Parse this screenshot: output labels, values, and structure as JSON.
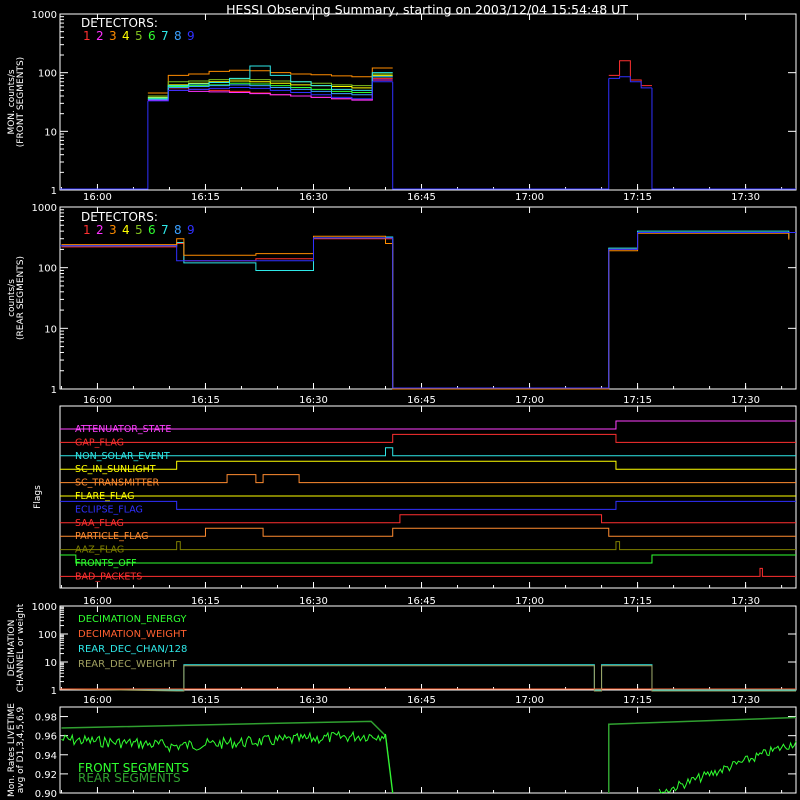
{
  "title": "HESSI Observing Summary, starting on 2003/12/04 15:54:48 UT",
  "time_ticks": [
    "16:00",
    "16:15",
    "16:30",
    "16:45",
    "17:00",
    "17:15",
    "17:30"
  ],
  "detectors": {
    "label": "DETECTORS:",
    "numbers": [
      "1",
      "2",
      "3",
      "4",
      "5",
      "6",
      "7",
      "8",
      "9"
    ],
    "colors": [
      "#ff3030",
      "#ff30ff",
      "#ff8c00",
      "#ffff00",
      "#80c020",
      "#30ff30",
      "#2ee8e8",
      "#3aa0ff",
      "#3030ff"
    ]
  },
  "panels": {
    "front": {
      "ylabel": [
        "MON. counts/s",
        "(FRONT SEGMENTS)"
      ],
      "yticks": [
        "1000",
        "100",
        "10",
        "1"
      ]
    },
    "rear": {
      "ylabel": [
        "counts/s",
        "(REAR SEGMENTS)"
      ],
      "yticks": [
        "1000",
        "100",
        "10",
        "1"
      ]
    },
    "flags": {
      "ylabel": [
        "Flags"
      ]
    },
    "decimation": {
      "ylabel": [
        "DECIMATION",
        "CHANNEL or weight"
      ],
      "yticks": [
        "1000",
        "100",
        "10",
        "1"
      ]
    },
    "livetime": {
      "ylabel": [
        "Mon. Rates LIVETIME",
        "avg of D1,3,4,5,6,9"
      ],
      "yticks": [
        "0.98",
        "0.96",
        "0.94",
        "0.92",
        "0.90"
      ]
    }
  },
  "flags": [
    {
      "name": "ATTENUATOR_STATE",
      "color": "#ff40ff"
    },
    {
      "name": "GAP_FLAG",
      "color": "#ff3030"
    },
    {
      "name": "NON_SOLAR_EVENT",
      "color": "#2ee8e8"
    },
    {
      "name": "SC_IN_SUNLIGHT",
      "color": "#ffff00"
    },
    {
      "name": "SC_TRANSMITTER",
      "color": "#ff8c30"
    },
    {
      "name": "FLARE_FLAG",
      "color": "#ffff00"
    },
    {
      "name": "ECLIPSE_FLAG",
      "color": "#3030ff"
    },
    {
      "name": "SAA_FLAG",
      "color": "#ff3030"
    },
    {
      "name": "PARTICLE_FLAG",
      "color": "#ff8c30"
    },
    {
      "name": "AAZ_FLAG",
      "color": "#808000"
    },
    {
      "name": "FRONTS_OFF",
      "color": "#30ff30"
    },
    {
      "name": "BAD_PACKETS",
      "color": "#ff3030"
    }
  ],
  "decimation_legend": [
    {
      "name": "DECIMATION_ENERGY",
      "color": "#30ff30"
    },
    {
      "name": "DECIMATION_WEIGHT",
      "color": "#ff6030"
    },
    {
      "name": "REAR_DEC_CHAN/128",
      "color": "#2ee8e8"
    },
    {
      "name": "REAR_DEC_WEIGHT",
      "color": "#a0a060"
    }
  ],
  "livetime_legend": [
    {
      "name": "FRONT SEGMENTS",
      "color": "#30ff30"
    },
    {
      "name": "REAR SEGMENTS",
      "color": "#30a030"
    }
  ],
  "chart_data": {
    "type": "line",
    "title": "HESSI Observing Summary, starting on 2003/12/04 15:54:48 UT",
    "x_unit": "UT time (minutes after 15:54:48)",
    "xlim": [
      "15:54:48",
      "17:37:00"
    ],
    "front_counts": {
      "yscale": "log",
      "ylim": [
        1,
        1000
      ],
      "segments": [
        {
          "start": "16:07",
          "end": "16:41",
          "series": [
            {
              "name": "1",
              "values": [
                35,
                55,
                52,
                50,
                48,
                45,
                42,
                40,
                38,
                36,
                35,
                80
              ]
            },
            {
              "name": "2",
              "values": [
                34,
                50,
                48,
                47,
                46,
                44,
                42,
                40,
                38,
                36,
                34,
                75
              ]
            },
            {
              "name": "3",
              "values": [
                45,
                90,
                95,
                105,
                110,
                108,
                100,
                95,
                92,
                88,
                85,
                120
              ]
            },
            {
              "name": "4",
              "values": [
                38,
                62,
                66,
                70,
                72,
                70,
                66,
                62,
                60,
                58,
                55,
                90
              ]
            },
            {
              "name": "5",
              "values": [
                40,
                70,
                72,
                76,
                78,
                76,
                72,
                70,
                66,
                62,
                60,
                95
              ]
            },
            {
              "name": "6",
              "values": [
                36,
                58,
                60,
                62,
                66,
                64,
                60,
                56,
                52,
                48,
                46,
                85
              ]
            },
            {
              "name": "7",
              "values": [
                37,
                60,
                64,
                68,
                80,
                130,
                90,
                70,
                60,
                52,
                50,
                100
              ]
            },
            {
              "name": "8",
              "values": [
                35,
                56,
                58,
                60,
                62,
                60,
                56,
                52,
                48,
                44,
                42,
                85
              ]
            },
            {
              "name": "9",
              "values": [
                33,
                50,
                52,
                54,
                56,
                54,
                50,
                46,
                42,
                38,
                36,
                70
              ]
            }
          ]
        },
        {
          "start": "17:11",
          "end": "17:17",
          "series": [
            {
              "name": "1",
              "values": [
                90,
                160,
                75,
                60
              ]
            },
            {
              "name": "9",
              "values": [
                80,
                85,
                70,
                55
              ]
            }
          ]
        }
      ]
    },
    "rear_counts": {
      "yscale": "log",
      "ylim": [
        1,
        1000
      ],
      "series": [
        {
          "name": "1",
          "x": [
            "15:55",
            "16:11",
            "16:12",
            "16:22",
            "16:30",
            "16:40",
            "16:41",
            "17:11",
            "17:15",
            "17:36"
          ],
          "values": [
            220,
            250,
            130,
            140,
            300,
            300,
            1,
            200,
            380,
            300
          ]
        },
        {
          "name": "7",
          "x": [
            "15:55",
            "16:11",
            "16:12",
            "16:22",
            "16:30",
            "16:40",
            "16:41",
            "17:11",
            "17:15",
            "17:36"
          ],
          "values": [
            230,
            260,
            120,
            90,
            310,
            320,
            1,
            210,
            400,
            310
          ]
        },
        {
          "name": "3",
          "x": [
            "15:55",
            "16:11",
            "16:12",
            "16:22",
            "16:30",
            "16:40",
            "16:41",
            "17:11",
            "17:15",
            "17:36"
          ],
          "values": [
            240,
            300,
            160,
            170,
            330,
            250,
            1,
            190,
            370,
            290
          ]
        }
      ]
    },
    "decimation": {
      "yscale": "log",
      "ylim": [
        1,
        1000
      ],
      "series": [
        {
          "name": "REAR_DEC_CHAN/128",
          "x": [
            "16:11",
            "16:12",
            "16:30",
            "17:09",
            "17:10",
            "17:16",
            "17:17"
          ],
          "values": [
            1,
            8,
            8,
            1,
            8,
            8,
            1
          ]
        },
        {
          "name": "REAR_DEC_WEIGHT",
          "x": [
            "16:11",
            "16:12",
            "16:30",
            "17:09",
            "17:10",
            "17:16",
            "17:17"
          ],
          "values": [
            1,
            8,
            8,
            1,
            8,
            8,
            1
          ]
        }
      ]
    },
    "livetime": {
      "ylim": [
        0.9,
        0.99
      ],
      "series": [
        {
          "name": "FRONT SEGMENTS",
          "x": [
            "15:55",
            "16:10",
            "16:30",
            "16:38",
            "16:40",
            "17:11",
            "17:18",
            "17:25",
            "17:36"
          ],
          "values": [
            0.962,
            0.955,
            0.965,
            0.968,
            0.9,
            0.9,
            0.9,
            0.935,
            0.955
          ]
        },
        {
          "name": "REAR SEGMENTS",
          "x": [
            "15:55",
            "16:10",
            "16:30",
            "16:40",
            "17:11",
            "17:36"
          ],
          "values": [
            0.968,
            0.97,
            0.975,
            0.9,
            0.97,
            0.978
          ]
        }
      ]
    }
  }
}
